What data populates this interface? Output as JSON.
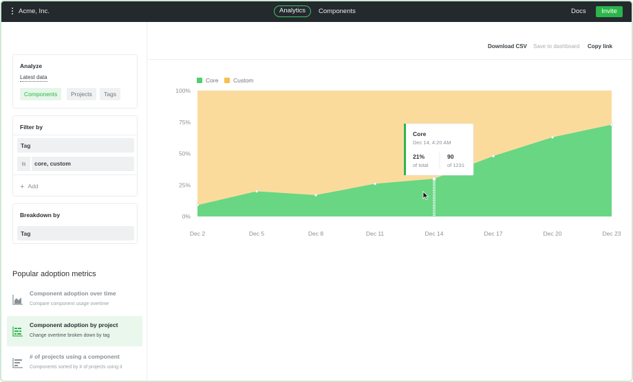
{
  "app": {
    "brand": "Acme, Inc."
  },
  "nav": {
    "analytics": "Analytics",
    "components": "Components",
    "docs": "Docs",
    "invite": "Invite"
  },
  "sidebar": {
    "analyze": {
      "title": "Analyze",
      "dataset": "Latest data",
      "chips": [
        "Components",
        "Projects",
        "Tags"
      ],
      "selected": "Components"
    },
    "filter": {
      "title": "Filter by",
      "field": "Tag",
      "operator": "is",
      "value": "core, custom",
      "add_label": "Add"
    },
    "breakdown": {
      "title": "Breakdown by",
      "field": "Tag"
    },
    "popular": {
      "title": "Popular adoption metrics",
      "items": [
        {
          "title": "Component adoption over time",
          "subtitle": "Compare component usage overtime",
          "icon": "area-chart-icon"
        },
        {
          "title": "Component adoption by project",
          "subtitle": "Change overtime broken down by tag",
          "icon": "stacked-bar-icon"
        },
        {
          "title": "# of projects using a component",
          "subtitle": "Components sorted by # of projects using it",
          "icon": "horizontal-bar-icon"
        }
      ],
      "active_index": 1
    }
  },
  "toolbar": {
    "download": "Download CSV",
    "save": "Save to dashboard",
    "copy": "Copy link"
  },
  "colors": {
    "core": "#68d683",
    "custom": "#fbdb9c",
    "accent": "#2bb54a"
  },
  "chart_data": {
    "type": "area",
    "stacked": "percent",
    "x": [
      "Dec 2",
      "Dec 5",
      "Dec 8",
      "Dec 11",
      "Dec 14",
      "Dec 17",
      "Dec 20",
      "Dec 23"
    ],
    "yticks": [
      "0%",
      "25%",
      "50%",
      "75%",
      "100%"
    ],
    "ylim": [
      0,
      100
    ],
    "series": [
      {
        "name": "Core",
        "values": [
          9,
          20,
          17,
          26,
          30,
          48,
          63,
          73
        ]
      },
      {
        "name": "Custom",
        "values": [
          91,
          80,
          83,
          74,
          70,
          52,
          37,
          27
        ]
      }
    ],
    "legend": "top-left",
    "tooltip": {
      "series": "Core",
      "date": "Dec 14,  4:20 AM",
      "pct": "21%",
      "pct_label": "of total",
      "count": "90",
      "count_label": "of 1231",
      "index": 4
    }
  }
}
